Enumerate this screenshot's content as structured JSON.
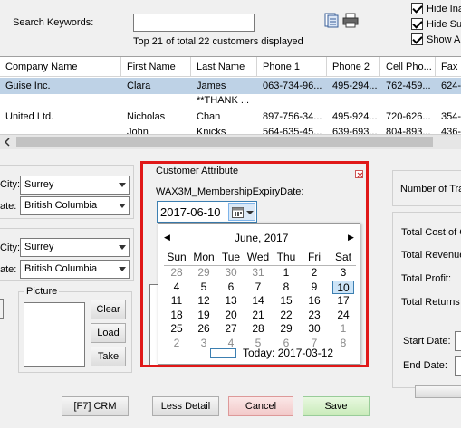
{
  "search": {
    "label": "Search Keywords:",
    "value": ""
  },
  "status_text": "Top 21 of total 22 customers displayed",
  "checkboxes": [
    {
      "label": "Hide Ina",
      "checked": true
    },
    {
      "label": "Hide Su",
      "checked": true
    },
    {
      "label": "Show A",
      "checked": true
    }
  ],
  "grid": {
    "columns": [
      "Company Name",
      "First Name",
      "Last Name",
      "Phone 1",
      "Phone 2",
      "Cell Pho...",
      "Fax"
    ],
    "rows": [
      [
        "Guise Inc.",
        "Clara",
        "James",
        "063-734-96...",
        "495-294...",
        "762-459...",
        "624-"
      ],
      [
        "",
        "",
        "**THANK ...",
        "",
        "",
        "",
        ""
      ],
      [
        "United Ltd.",
        "Nicholas",
        "Chan",
        "897-756-34...",
        "495-924...",
        "720-626...",
        "354-"
      ],
      [
        "",
        "John",
        "Knicks",
        "564-635-45...",
        "639-693...",
        "804-893...",
        "436-"
      ]
    ]
  },
  "left_panel": {
    "city1_label": "City:",
    "city1_value": "Surrey",
    "state1_label": "ate:",
    "state1_value": "British Columbia",
    "city2_label": "City:",
    "city2_value": "Surrey",
    "state2_label": "ate:",
    "state2_value": "British Columbia",
    "picture_label": "Picture",
    "clear_btn": "Clear",
    "load_btn": "Load",
    "take_btn": "Take"
  },
  "customer_attribute": {
    "title": "Customer Attribute",
    "field_label": "WAX3M_MembershipExpiryDate:",
    "date_value": "2017-06-10"
  },
  "calendar": {
    "month_title": "June, 2017",
    "prev_icon": "◀",
    "next_icon": "▶",
    "dow": [
      "Sun",
      "Mon",
      "Tue",
      "Wed",
      "Thu",
      "Fri",
      "Sat"
    ],
    "weeks": [
      [
        "28",
        "29",
        "30",
        "31",
        "1",
        "2",
        "3"
      ],
      [
        "4",
        "5",
        "6",
        "7",
        "8",
        "9",
        "10"
      ],
      [
        "11",
        "12",
        "13",
        "14",
        "15",
        "16",
        "17"
      ],
      [
        "18",
        "19",
        "20",
        "21",
        "22",
        "23",
        "24"
      ],
      [
        "25",
        "26",
        "27",
        "28",
        "29",
        "30",
        "1"
      ],
      [
        "2",
        "3",
        "4",
        "5",
        "6",
        "7",
        "8"
      ]
    ],
    "today_label": "Today: 2017-03-12",
    "selected": "10"
  },
  "right_panel": {
    "number_of_tra": "Number of Tra",
    "total_cost": "Total Cost of C",
    "total_revenue": "Total Revenue",
    "total_profit": "Total Profit:",
    "total_returns": "Total Returns",
    "start_date": "Start Date:",
    "end_date": "End Date:"
  },
  "buttons": {
    "crm": "[F7] CRM",
    "less_detail": "Less Detail",
    "cancel": "Cancel",
    "save": "Save"
  },
  "colors": {
    "selected_row": "#bed2e6",
    "highlight_frame": "#e01818",
    "cancel_bg": "#f7d9d9",
    "save_bg": "#d9f2d0"
  }
}
